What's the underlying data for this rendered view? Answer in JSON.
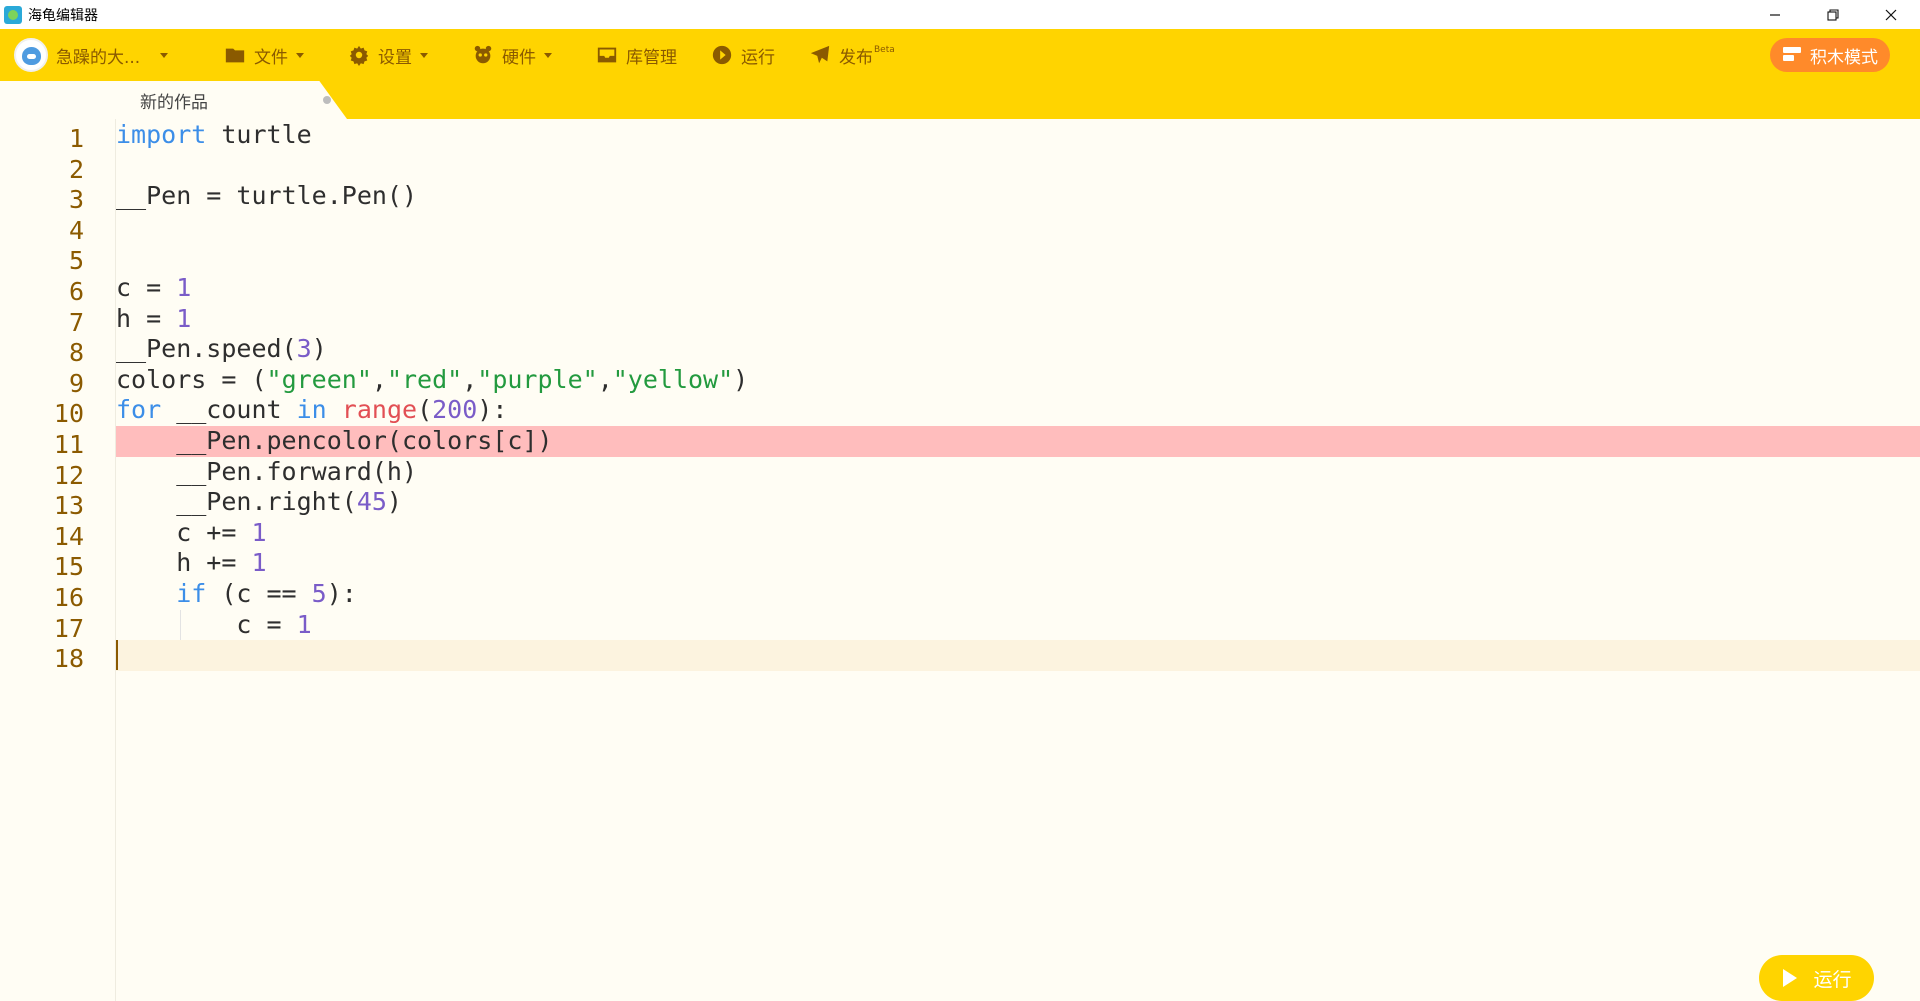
{
  "window": {
    "title": "海龟编辑器",
    "controls": [
      "minimize",
      "restore",
      "close"
    ]
  },
  "toolbar": {
    "user_name": "急躁的大...",
    "items": [
      {
        "label": "文件",
        "icon": "folder-icon",
        "dropdown": true
      },
      {
        "label": "设置",
        "icon": "gear-icon",
        "dropdown": true
      },
      {
        "label": "硬件",
        "icon": "hardware-icon",
        "dropdown": true
      },
      {
        "label": "库管理",
        "icon": "library-icon",
        "dropdown": false
      },
      {
        "label": "运行",
        "icon": "play-circle-icon",
        "dropdown": false
      },
      {
        "label": "发布",
        "icon": "send-icon",
        "dropdown": false,
        "badge": "Beta"
      }
    ],
    "block_mode_label": "积木模式"
  },
  "tabs": [
    {
      "label": "新的作品",
      "modified": true
    }
  ],
  "editor": {
    "error_line": 11,
    "current_line": 18,
    "lines": [
      {
        "n": "1",
        "indent": 0,
        "tokens": [
          {
            "t": "import",
            "c": "kw"
          },
          {
            "t": " turtle",
            "c": ""
          }
        ]
      },
      {
        "n": "2",
        "indent": 0,
        "tokens": []
      },
      {
        "n": "3",
        "indent": 0,
        "tokens": [
          {
            "t": "__Pen = turtle.Pen()",
            "c": ""
          }
        ]
      },
      {
        "n": "4",
        "indent": 0,
        "tokens": []
      },
      {
        "n": "5",
        "indent": 0,
        "tokens": []
      },
      {
        "n": "6",
        "indent": 0,
        "tokens": [
          {
            "t": "c = ",
            "c": ""
          },
          {
            "t": "1",
            "c": "num"
          }
        ]
      },
      {
        "n": "7",
        "indent": 0,
        "tokens": [
          {
            "t": "h = ",
            "c": ""
          },
          {
            "t": "1",
            "c": "num"
          }
        ]
      },
      {
        "n": "8",
        "indent": 0,
        "tokens": [
          {
            "t": "__Pen.speed(",
            "c": ""
          },
          {
            "t": "3",
            "c": "num"
          },
          {
            "t": ")",
            "c": ""
          }
        ]
      },
      {
        "n": "9",
        "indent": 0,
        "tokens": [
          {
            "t": "colors = (",
            "c": ""
          },
          {
            "t": "\"green\"",
            "c": "str"
          },
          {
            "t": ",",
            "c": ""
          },
          {
            "t": "\"red\"",
            "c": "str"
          },
          {
            "t": ",",
            "c": ""
          },
          {
            "t": "\"purple\"",
            "c": "str"
          },
          {
            "t": ",",
            "c": ""
          },
          {
            "t": "\"yellow\"",
            "c": "str"
          },
          {
            "t": ")",
            "c": ""
          }
        ]
      },
      {
        "n": "10",
        "indent": 0,
        "tokens": [
          {
            "t": "for",
            "c": "kw"
          },
          {
            "t": " __count ",
            "c": ""
          },
          {
            "t": "in",
            "c": "kw"
          },
          {
            "t": " ",
            "c": ""
          },
          {
            "t": "range",
            "c": "bi"
          },
          {
            "t": "(",
            "c": ""
          },
          {
            "t": "200",
            "c": "num"
          },
          {
            "t": "):",
            "c": ""
          }
        ]
      },
      {
        "n": "11",
        "indent": 1,
        "tokens": [
          {
            "t": "__Pen.pencolor(colors[c])",
            "c": ""
          }
        ]
      },
      {
        "n": "12",
        "indent": 1,
        "tokens": [
          {
            "t": "__Pen.forward(h)",
            "c": ""
          }
        ]
      },
      {
        "n": "13",
        "indent": 1,
        "tokens": [
          {
            "t": "__Pen.right(",
            "c": ""
          },
          {
            "t": "45",
            "c": "num"
          },
          {
            "t": ")",
            "c": ""
          }
        ]
      },
      {
        "n": "14",
        "indent": 1,
        "tokens": [
          {
            "t": "c += ",
            "c": ""
          },
          {
            "t": "1",
            "c": "num"
          }
        ]
      },
      {
        "n": "15",
        "indent": 1,
        "tokens": [
          {
            "t": "h += ",
            "c": ""
          },
          {
            "t": "1",
            "c": "num"
          }
        ]
      },
      {
        "n": "16",
        "indent": 1,
        "tokens": [
          {
            "t": "if",
            "c": "kw"
          },
          {
            "t": " (c == ",
            "c": ""
          },
          {
            "t": "5",
            "c": "num"
          },
          {
            "t": "):",
            "c": ""
          }
        ]
      },
      {
        "n": "17",
        "indent": 2,
        "tokens": [
          {
            "t": "c = ",
            "c": ""
          },
          {
            "t": "1",
            "c": "num"
          }
        ]
      },
      {
        "n": "18",
        "indent": 0,
        "tokens": []
      }
    ]
  },
  "run_button": {
    "label": "运行"
  },
  "colors": {
    "toolbar_bg": "#ffd400",
    "accent_orange": "#ff8a2a",
    "editor_bg": "#fffdf4",
    "error_highlight": "#ffbdbd",
    "keyword": "#3c8ee8",
    "number": "#7a5cc8",
    "string": "#239a3f",
    "builtin": "#e24f54",
    "line_number": "#8b5a00"
  }
}
